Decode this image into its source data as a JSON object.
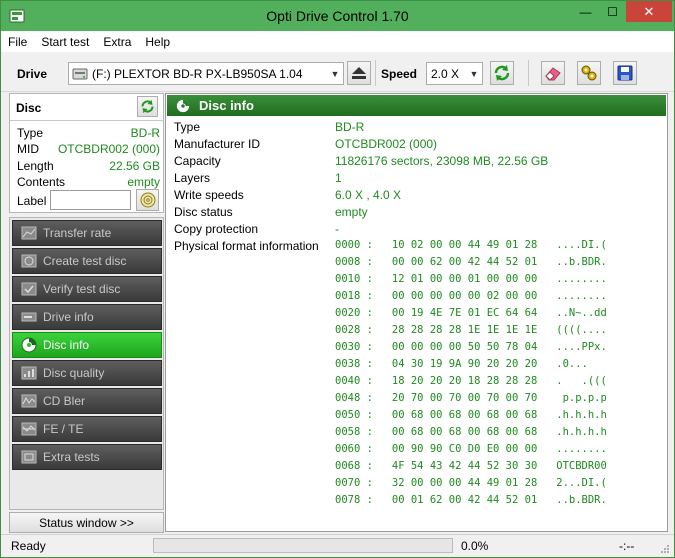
{
  "window": {
    "title": "Opti Drive Control 1.70",
    "minimize_glyph": "—",
    "maximize_glyph": "☐",
    "close_glyph": "✕"
  },
  "menu": {
    "items": [
      "File",
      "Start test",
      "Extra",
      "Help"
    ]
  },
  "toolbar": {
    "drive_label": "Drive",
    "drive_value": "(F:)  PLEXTOR BD-R  PX-LB950SA 1.04",
    "speed_label": "Speed",
    "speed_value": "2.0 X",
    "icons": [
      "eject-icon",
      "refresh-icon",
      "eraser-icon",
      "tools-icon",
      "save-icon"
    ]
  },
  "disc": {
    "title": "Disc",
    "rows": [
      {
        "key": "Type",
        "value": "BD-R"
      },
      {
        "key": "MID",
        "value": "OTCBDR002 (000)"
      },
      {
        "key": "Length",
        "value": "22.56 GB"
      },
      {
        "key": "Contents",
        "value": "empty"
      }
    ],
    "label_caption": "Label",
    "label_value": ""
  },
  "nav": {
    "items": [
      {
        "label": "Transfer rate",
        "icon": "transfer-rate-icon",
        "active": false
      },
      {
        "label": "Create test disc",
        "icon": "create-disc-icon",
        "active": false
      },
      {
        "label": "Verify test disc",
        "icon": "verify-disc-icon",
        "active": false
      },
      {
        "label": "Drive info",
        "icon": "drive-info-icon",
        "active": false
      },
      {
        "label": "Disc info",
        "icon": "disc-info-icon",
        "active": true
      },
      {
        "label": "Disc quality",
        "icon": "disc-quality-icon",
        "active": false
      },
      {
        "label": "CD Bler",
        "icon": "cd-bler-icon",
        "active": false
      },
      {
        "label": "FE / TE",
        "icon": "fe-te-icon",
        "active": false
      },
      {
        "label": "Extra tests",
        "icon": "extra-tests-icon",
        "active": false
      }
    ],
    "status_button": "Status window >>"
  },
  "disc_info": {
    "title": "Disc info",
    "rows": [
      {
        "key": "Type",
        "value": "BD-R"
      },
      {
        "key": "Manufacturer ID",
        "value": "OTCBDR002 (000)"
      },
      {
        "key": "Capacity",
        "value": "11826176 sectors, 23098 MB, 22.56 GB"
      },
      {
        "key": "Layers",
        "value": "1"
      },
      {
        "key": "Write speeds",
        "value": "6.0 X , 4.0 X"
      },
      {
        "key": "Disc status",
        "value": "empty"
      },
      {
        "key": "Copy protection",
        "value": "-"
      },
      {
        "key": "Physical format information",
        "value": ""
      }
    ],
    "hex_dump": [
      "0000 :   10 02 00 00 44 49 01 28   ....DI.(",
      "0008 :   00 00 62 00 42 44 52 01   ..b.BDR.",
      "0010 :   12 01 00 00 01 00 00 00   ........",
      "0018 :   00 00 00 00 00 02 00 00   ........",
      "0020 :   00 19 4E 7E 01 EC 64 64   ..N~..dd",
      "0028 :   28 28 28 28 1E 1E 1E 1E   ((((....",
      "0030 :   00 00 00 00 50 50 78 04   ....PPx.",
      "0038 :   04 30 19 9A 90 20 20 20   .0...   ",
      "0040 :   18 20 20 20 18 28 28 28   .   .(((",
      "0048 :   20 70 00 70 00 70 00 70    p.p.p.p",
      "0050 :   00 68 00 68 00 68 00 68   .h.h.h.h",
      "0058 :   00 68 00 68 00 68 00 68   .h.h.h.h",
      "0060 :   00 90 90 C0 D0 E0 00 00   ........",
      "0068 :   4F 54 43 42 44 52 30 30   OTCBDR00",
      "0070 :   32 00 00 00 44 49 01 28   2...DI.(",
      "0078 :   00 01 62 00 42 44 52 01   ..b.BDR."
    ]
  },
  "statusbar": {
    "status": "Ready",
    "progress_fraction": 0.0,
    "percent": "0.0%",
    "time": "-:--"
  },
  "colors": {
    "title_bar": "#52b05d",
    "value_green": "#1f8a1f",
    "active_nav": "#2bbf2b",
    "section_header": "#2a7f2a"
  }
}
